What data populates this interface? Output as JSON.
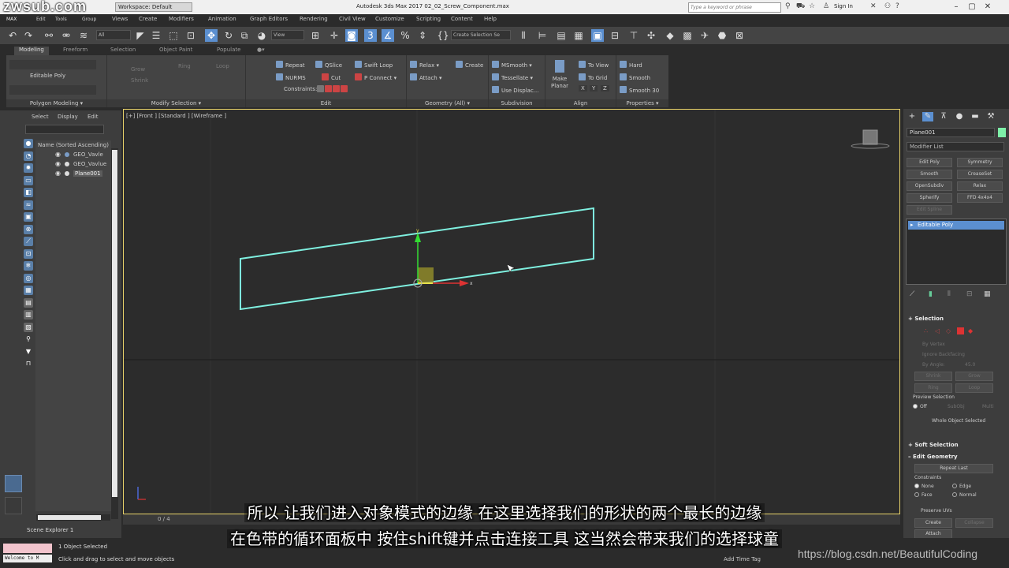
{
  "titlebar": {
    "watermark_logo": "zwsub.com",
    "workspace": "Workspace: Default",
    "app_title": "Autodesk 3ds Max 2017     02_02_Screw_Component.max",
    "search_placeholder": "Type a keyword or phrase",
    "sign_in": "Sign In"
  },
  "menu": [
    "Views",
    "Create",
    "Modifiers",
    "Animation",
    "Graph Editors",
    "Rendering",
    "Civil View",
    "Customize",
    "Scripting",
    "Content",
    "Help"
  ],
  "menu_left": [
    "MAX",
    "Edit",
    "Tools",
    "Group"
  ],
  "toolbar": {
    "filter_value": "All",
    "view_value": "View",
    "selection_set_placeholder": "Create Selection Se"
  },
  "ribbon_tabs": [
    "Modeling",
    "Freeform",
    "Selection",
    "Object Paint",
    "Populate"
  ],
  "ribbon": {
    "polygon_modeling": {
      "item": "Editable Poly",
      "label": "Polygon Modeling ▾"
    },
    "modify_selection": {
      "items": [
        "Grow",
        "Shrink",
        "Ring",
        "Loop"
      ],
      "label": "Modify Selection ▾"
    },
    "edit": {
      "items": [
        "Repeat",
        "QSlice",
        "Swift Loop",
        "NURMS",
        "Cut",
        "P Connect ▾",
        "Constraints:"
      ],
      "label": "Edit"
    },
    "geometry": {
      "items": [
        "Relax ▾",
        "Create",
        "Attach ▾"
      ],
      "label": "Geometry (All) ▾"
    },
    "subdivision": {
      "items": [
        "MSmooth ▾",
        "Tessellate ▾",
        "Use Displac..."
      ],
      "label": "Subdivision"
    },
    "align": {
      "items": [
        "Make Planar",
        "To View",
        "To Grid",
        "X",
        "Y",
        "Z"
      ],
      "label": "Align"
    },
    "properties": {
      "items": [
        "Hard",
        "Smooth",
        "Smooth 30"
      ],
      "label": "Properties ▾"
    }
  },
  "explorer": {
    "menus": [
      "Select",
      "Display",
      "Edit"
    ],
    "header": "Name (Sorted Ascending)",
    "rows": [
      "GEO_Vavle",
      "GEO_Vavlue",
      "Plane001"
    ],
    "footer": "Scene Explorer 1"
  },
  "viewport": {
    "label": "[+] [Front ] [Standard ] [Wireframe ]",
    "frame_counter": "0 / 4",
    "axis_x": "x",
    "axis_y": "y"
  },
  "command_panel": {
    "object_name": "Plane001",
    "modifier_list": "Modifier List",
    "buttons": [
      {
        "label": "Edit Poly",
        "enabled": true
      },
      {
        "label": "Symmetry",
        "enabled": true
      },
      {
        "label": "Smooth",
        "enabled": true
      },
      {
        "label": "CreaseSet",
        "enabled": true
      },
      {
        "label": "OpenSubdiv",
        "enabled": true
      },
      {
        "label": "Relax",
        "enabled": true
      },
      {
        "label": "Spherify",
        "enabled": true
      },
      {
        "label": "FFD 4x4x4",
        "enabled": true
      },
      {
        "label": "Edit Spline",
        "enabled": false
      }
    ],
    "stack_item": "Editable Poly",
    "selection": {
      "title": "Selection",
      "by_vertex": "By Vertex",
      "ignore_backfacing": "Ignore Backfacing",
      "by_angle": "By Angle:",
      "angle_value": "45.0",
      "shrink": "Shrink",
      "grow": "Grow",
      "ring": "Ring",
      "loop": "Loop",
      "preview_selection": "Preview Selection",
      "preview_off": "Off",
      "preview_subobj": "SubObj",
      "preview_multi": "Multi",
      "whole_object": "Whole Object Selected"
    },
    "soft_selection": "Soft Selection",
    "edit_geometry": {
      "title": "Edit Geometry",
      "repeat_last": "Repeat Last",
      "constraints": "Constraints",
      "none": "None",
      "edge": "Edge",
      "face": "Face",
      "normal": "Normal",
      "preserve_uvs": "Preserve UVs",
      "create": "Create",
      "collapse": "Collapse",
      "attach": "Attach"
    }
  },
  "status": {
    "welcome": "Welcome to M",
    "objects_selected": "1 Object Selected",
    "hint": "Click and drag to select and move objects",
    "add_time_tag": "Add Time Tag",
    "watermark_url": "https://blog.csdn.net/BeautifulCoding"
  },
  "subtitles": {
    "line1": "所以  让我们进入对象模式的边缘  在这里选择我们的形状的两个最长的边缘",
    "line2": "在色带的循环面板中  按住shift键并点击连接工具  这当然会带来我们的选择球童"
  },
  "colors": {
    "viewport_border": "#e9d36a",
    "wireframe": "#7ff0e0",
    "selection_blue": "#5b8fd0",
    "object_color": "#7ef0a8"
  }
}
